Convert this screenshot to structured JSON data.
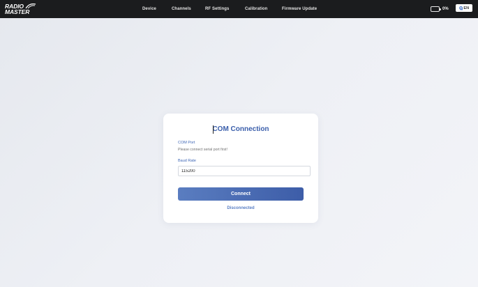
{
  "brand": {
    "logo_line1": "RADIO",
    "logo_line2": "MASTER"
  },
  "nav": {
    "items": [
      {
        "label": "Device"
      },
      {
        "label": "Channels"
      },
      {
        "label": "RF Settings"
      },
      {
        "label": "Calibration"
      },
      {
        "label": "Firmware Update"
      }
    ]
  },
  "header_right": {
    "battery_icon": "battery-icon",
    "battery_text": "0%",
    "language_icon": "globe-icon",
    "language_label": "EN"
  },
  "card": {
    "title": "COM Connection",
    "com_port_label": "COM Port",
    "com_port_hint": "Please connect serial port first!",
    "baud_rate_label": "Baud Rate",
    "baud_rate_value": "115200",
    "connect_label": "Connect",
    "status_text": "Disconnected"
  },
  "colors": {
    "topbar": "#1b1c1e",
    "accent": "#3d5da8",
    "label_blue": "#3f67b6"
  }
}
